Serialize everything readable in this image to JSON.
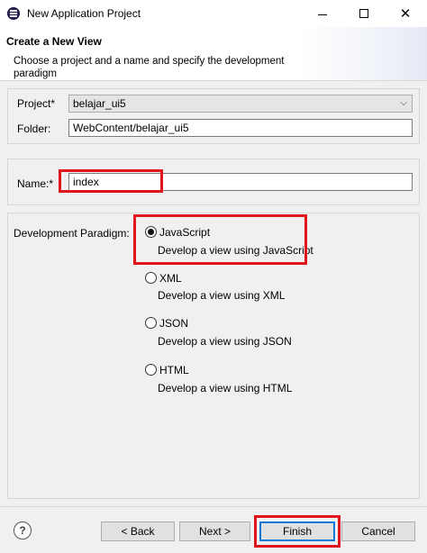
{
  "window": {
    "title": "New Application Project",
    "controls": {
      "minimize": "minimize-icon",
      "maximize": "maximize-icon",
      "close": "close-icon"
    }
  },
  "banner": {
    "title": "Create a New View",
    "description": "Choose a project and a name and specify the development paradigm"
  },
  "project": {
    "label": "Project",
    "required_marker": "*",
    "value": "belajar_ui5"
  },
  "folder": {
    "label": "Folder:",
    "value": "WebContent/belajar_ui5"
  },
  "name": {
    "label": "Name:",
    "required_marker": "*",
    "value": "index"
  },
  "paradigm": {
    "label": "Development Paradigm:",
    "options": [
      {
        "label": "JavaScript",
        "description": "Develop a view using JavaScript",
        "selected": true
      },
      {
        "label": "XML",
        "description": "Develop a view using XML",
        "selected": false
      },
      {
        "label": "JSON",
        "description": "Develop a view using JSON",
        "selected": false
      },
      {
        "label": "HTML",
        "description": "Develop a view using HTML",
        "selected": false
      }
    ]
  },
  "buttons": {
    "help": "?",
    "back": "< Back",
    "next": "Next >",
    "finish": "Finish",
    "cancel": "Cancel"
  },
  "colors": {
    "highlight": "#e0141b",
    "default_button_border": "#0078d7"
  }
}
